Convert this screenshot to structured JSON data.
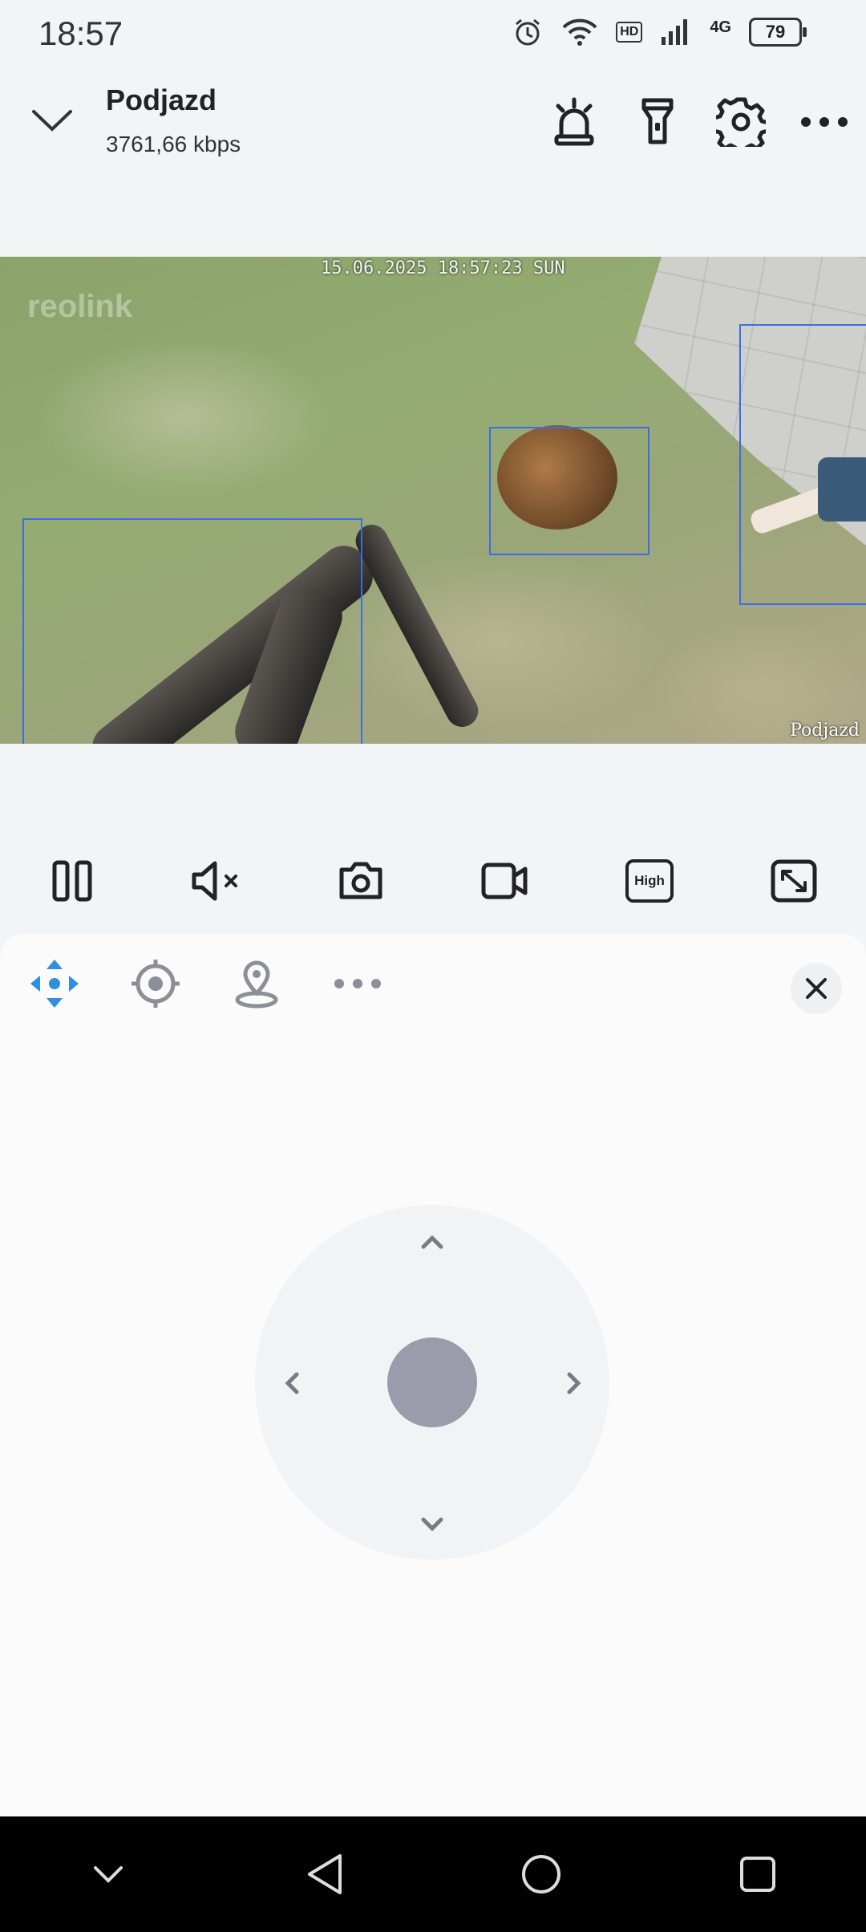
{
  "status_bar": {
    "time": "18:57",
    "hd_label": "HD",
    "network_label": "4G",
    "battery": "79",
    "icons": [
      "alarm-icon",
      "wifi-icon",
      "hd-icon",
      "signal-icon",
      "battery-icon"
    ]
  },
  "header": {
    "title": "Podjazd",
    "bitrate": "3761,66 kbps",
    "icons": [
      "chevron-down-icon",
      "siren-icon",
      "flashlight-icon",
      "gear-icon",
      "more-icon"
    ]
  },
  "video": {
    "timestamp": "15.06.2025 18:57:23 SUN",
    "watermark": "reolink",
    "camera_name": "Podjazd"
  },
  "controls": {
    "quality_label": "High",
    "icons": [
      "pause-icon",
      "mute-icon",
      "snapshot-icon",
      "record-icon",
      "quality-icon",
      "fullscreen-icon"
    ]
  },
  "ptz_panel": {
    "tabs": [
      "ptz-move-icon",
      "preset-icon",
      "patrol-icon",
      "more-icon"
    ],
    "active_tab": "ptz-move-icon",
    "accent_color": "#2f8fe0"
  },
  "nav_bar": {
    "icons": [
      "hide-keyboard-icon",
      "back-icon",
      "home-icon",
      "recents-icon"
    ]
  }
}
